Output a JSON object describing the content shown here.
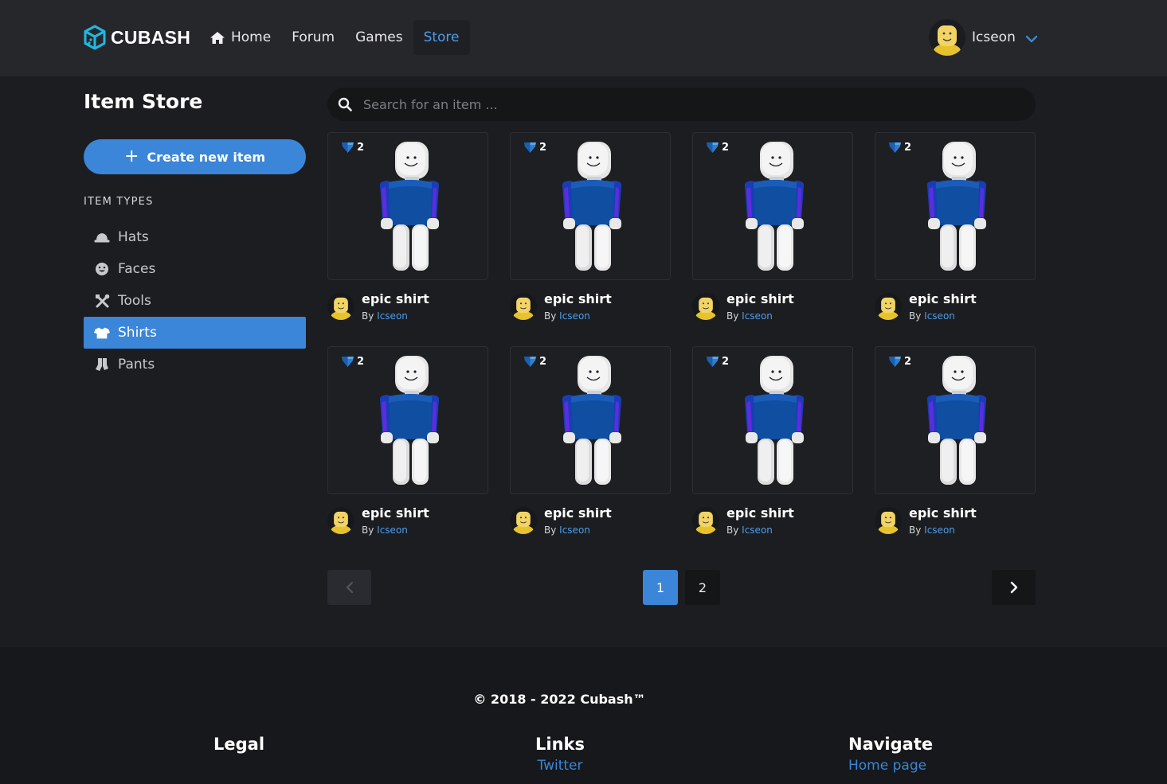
{
  "nav": {
    "brand": "CUBASH",
    "links": [
      {
        "label": "Home",
        "icon": "home-icon"
      },
      {
        "label": "Forum"
      },
      {
        "label": "Games"
      },
      {
        "label": "Store",
        "active": true
      }
    ],
    "user": {
      "name": "Icseon"
    }
  },
  "sidebar": {
    "title": "Item Store",
    "create_label": "Create new item",
    "section_label": "ITEM TYPES",
    "types": [
      {
        "label": "Hats",
        "icon": "hat-icon"
      },
      {
        "label": "Faces",
        "icon": "face-icon"
      },
      {
        "label": "Tools",
        "icon": "tools-icon"
      },
      {
        "label": "Shirts",
        "icon": "shirt-icon",
        "active": true
      },
      {
        "label": "Pants",
        "icon": "pants-icon"
      }
    ]
  },
  "search": {
    "placeholder": "Search for an item ..."
  },
  "items": [
    {
      "name": "epic shirt",
      "by": "By",
      "creator": "Icseon",
      "price": "2"
    },
    {
      "name": "epic shirt",
      "by": "By",
      "creator": "Icseon",
      "price": "2"
    },
    {
      "name": "epic shirt",
      "by": "By",
      "creator": "Icseon",
      "price": "2"
    },
    {
      "name": "epic shirt",
      "by": "By",
      "creator": "Icseon",
      "price": "2"
    },
    {
      "name": "epic shirt",
      "by": "By",
      "creator": "Icseon",
      "price": "2"
    },
    {
      "name": "epic shirt",
      "by": "By",
      "creator": "Icseon",
      "price": "2"
    },
    {
      "name": "epic shirt",
      "by": "By",
      "creator": "Icseon",
      "price": "2"
    },
    {
      "name": "epic shirt",
      "by": "By",
      "creator": "Icseon",
      "price": "2"
    }
  ],
  "pagination": {
    "pages": [
      "1",
      "2"
    ],
    "current": "1"
  },
  "footer": {
    "copyright": "© 2018 - 2022 Cubash™",
    "legal_title": "Legal",
    "links_title": "Links",
    "links": [
      "Twitter"
    ],
    "navigate_title": "Navigate",
    "navigate": [
      "Home page"
    ]
  },
  "colors": {
    "accent": "#3b86d8",
    "link": "#4d9de8",
    "bg": "#1c1d20",
    "navbar": "#26272b",
    "footer": "#17181b"
  }
}
